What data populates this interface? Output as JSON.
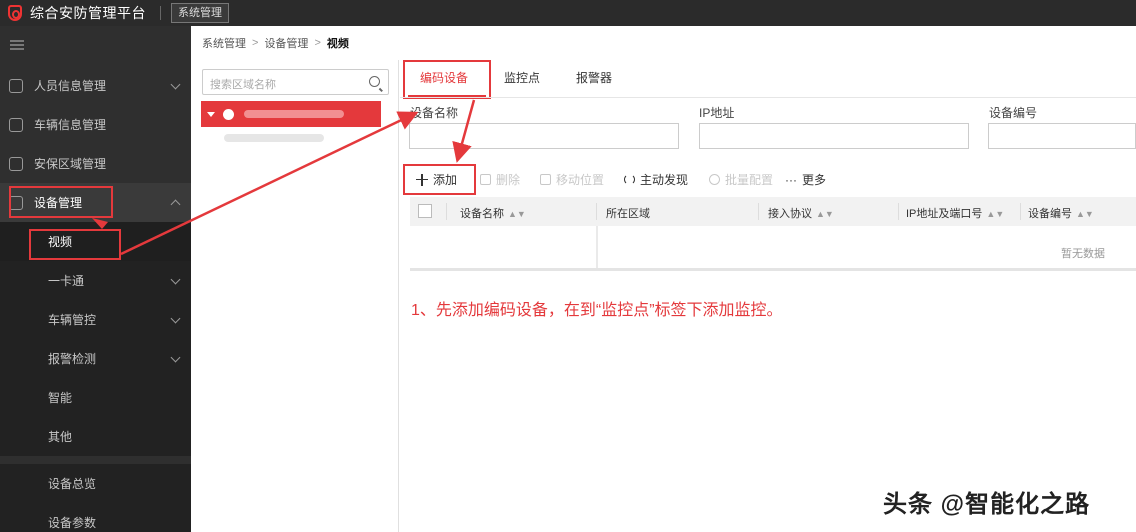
{
  "app": {
    "title": "综合安防管理平台",
    "system_button": "系统管理"
  },
  "sidebar": {
    "items": [
      {
        "label": "人员信息管理",
        "icon": "person-icon"
      },
      {
        "label": "车辆信息管理",
        "icon": "car-icon"
      },
      {
        "label": "安保区域管理",
        "icon": "home-icon"
      },
      {
        "label": "设备管理",
        "icon": "device-icon"
      }
    ],
    "sub_items": [
      {
        "label": "视频"
      },
      {
        "label": "一卡通"
      },
      {
        "label": "车辆管控"
      },
      {
        "label": "报警检测"
      },
      {
        "label": "智能"
      },
      {
        "label": "其他"
      },
      {
        "label": "设备总览"
      },
      {
        "label": "设备参数"
      }
    ]
  },
  "breadcrumb": {
    "a": "系统管理",
    "b": "设备管理",
    "c": "视频"
  },
  "tree": {
    "search_placeholder": "搜索区域名称"
  },
  "tabs": [
    {
      "label": "编码设备"
    },
    {
      "label": "监控点"
    },
    {
      "label": "报警器"
    }
  ],
  "filters": {
    "device_name": "设备名称",
    "ip": "IP地址",
    "device_no": "设备编号"
  },
  "toolbar": {
    "add": "添加",
    "delete": "删除",
    "move": "移动位置",
    "discover": "主动发现",
    "batch": "批量配置",
    "more": "更多"
  },
  "table": {
    "columns": [
      "设备名称",
      "所在区域",
      "接入协议",
      "IP地址及端口号",
      "设备编号"
    ],
    "empty_text": "暂无数据"
  },
  "annotation": "1、先添加编码设备，在到“监控点”标签下添加监控。",
  "watermark": "头条 @智能化之路",
  "colors": {
    "accent": "#e4393c",
    "sidebar": "#2f2f2f",
    "topbar": "#2b2b2b"
  }
}
